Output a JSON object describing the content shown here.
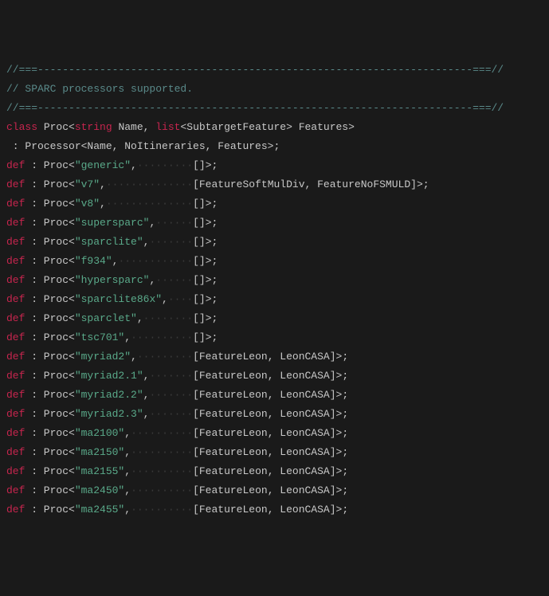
{
  "header": {
    "sep1": "//===----------------------------------------------------------------------===//",
    "title": "// SPARC processors supported.",
    "sep2": "//===----------------------------------------------------------------------===//"
  },
  "classdef": {
    "kw_class": "class",
    "sp1": " Proc<",
    "kw_string": "string",
    "sp2": " Name, ",
    "kw_list": "list",
    "sp3": "<SubtargetFeature> Features>",
    "line2": " : Processor<Name, NoItineraries, Features>;"
  },
  "defs": [
    {
      "name": "generic",
      "pad": 9,
      "comma_after": true,
      "features": "[]"
    },
    {
      "name": "v7",
      "pad": 14,
      "comma_after": true,
      "features": "[FeatureSoftMulDiv, FeatureNoFSMULD]"
    },
    {
      "name": "v8",
      "pad": 14,
      "comma_after": true,
      "features": "[]"
    },
    {
      "name": "supersparc",
      "pad": 6,
      "comma_after": true,
      "features": "[]"
    },
    {
      "name": "sparclite",
      "pad": 7,
      "comma_after": true,
      "features": "[]"
    },
    {
      "name": "f934",
      "pad": 12,
      "comma_after": true,
      "features": "[]"
    },
    {
      "name": "hypersparc",
      "pad": 6,
      "comma_after": true,
      "features": "[]"
    },
    {
      "name": "sparclite86x",
      "pad": 4,
      "comma_after": true,
      "features": "[]"
    },
    {
      "name": "sparclet",
      "pad": 8,
      "comma_after": true,
      "features": "[]"
    },
    {
      "name": "tsc701",
      "pad": 10,
      "comma_after": true,
      "features": "[]"
    },
    {
      "name": "myriad2",
      "pad": 9,
      "comma_after": true,
      "features": "[FeatureLeon, LeonCASA]"
    },
    {
      "name": "myriad2.1",
      "pad": 7,
      "comma_after": true,
      "features": "[FeatureLeon, LeonCASA]"
    },
    {
      "name": "myriad2.2",
      "pad": 7,
      "comma_after": true,
      "features": "[FeatureLeon, LeonCASA]"
    },
    {
      "name": "myriad2.3",
      "pad": 7,
      "comma_after": true,
      "features": "[FeatureLeon, LeonCASA]"
    },
    {
      "name": "ma2100",
      "pad": 10,
      "comma_after": true,
      "features": "[FeatureLeon, LeonCASA]"
    },
    {
      "name": "ma2150",
      "pad": 10,
      "comma_after": true,
      "features": "[FeatureLeon, LeonCASA]"
    },
    {
      "name": "ma2155",
      "pad": 10,
      "comma_after": true,
      "features": "[FeatureLeon, LeonCASA]"
    },
    {
      "name": "ma2450",
      "pad": 10,
      "comma_after": true,
      "features": "[FeatureLeon, LeonCASA]"
    },
    {
      "name": "ma2455",
      "pad": 10,
      "comma_after": true,
      "features": "[FeatureLeon, LeonCASA]"
    }
  ],
  "tokens": {
    "def": "def",
    "proc_open": " : Proc<",
    "q": "\"",
    "close": ">;"
  }
}
